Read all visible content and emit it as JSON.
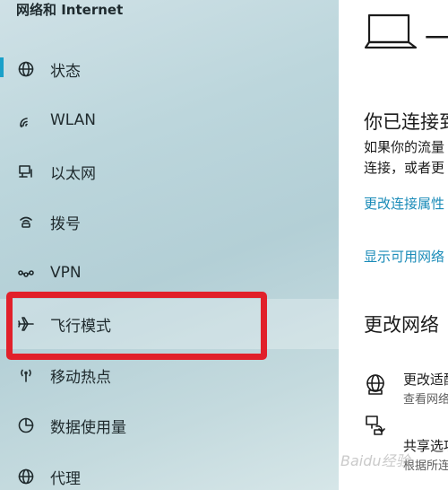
{
  "sidebar": {
    "title": "网络和 Internet",
    "items": [
      {
        "label": "状态",
        "icon": "globe-icon"
      },
      {
        "label": "WLAN",
        "icon": "wifi-icon"
      },
      {
        "label": "以太网",
        "icon": "ethernet-icon"
      },
      {
        "label": "拨号",
        "icon": "dialup-icon"
      },
      {
        "label": "VPN",
        "icon": "vpn-icon"
      },
      {
        "label": "飞行模式",
        "icon": "airplane-icon"
      },
      {
        "label": "移动热点",
        "icon": "hotspot-icon"
      },
      {
        "label": "数据使用量",
        "icon": "data-usage-icon"
      },
      {
        "label": "代理",
        "icon": "proxy-globe-icon"
      }
    ],
    "active_index": 0,
    "highlighted_label": "飞行模式",
    "accent_color": "#1aa0c9",
    "highlight_color": "#e1202a"
  },
  "main": {
    "device_dash": "一",
    "status_heading": "你已连接到",
    "status_line1": "如果你的流量",
    "status_line2": "连接，或者更",
    "link_properties": "更改连接属性",
    "link_show_networks": "显示可用网络",
    "section_heading": "更改网络",
    "settings": [
      {
        "title": "更改适配",
        "desc": "查看网络",
        "icon": "adapter-globe-icon"
      },
      {
        "title": "共享选项",
        "desc": "根据所连",
        "icon": "sharing-icon"
      }
    ],
    "link_color": "#1a8bb8"
  },
  "watermark": "Baidu经验"
}
